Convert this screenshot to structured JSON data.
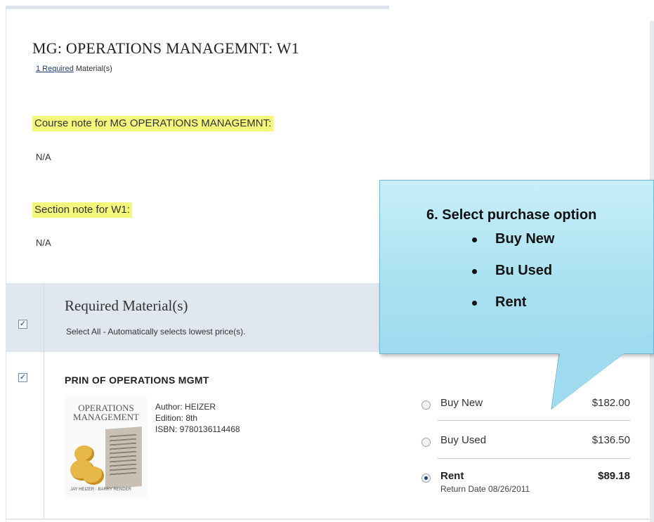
{
  "course": {
    "title": "MG:  OPERATIONS MANAGEMNT:  W1",
    "required_link": "1 Required",
    "required_suffix": " Material(s)"
  },
  "notes": {
    "course_note_label": "Course note for  MG  OPERATIONS MANAGEMNT:",
    "course_note_value": "N/A",
    "section_note_label": "Section note for W1:",
    "section_note_value": "N/A"
  },
  "required_section": {
    "title": "Required Material(s)",
    "select_all_text": "Select All - Automatically selects lowest price(s).",
    "select_all_checked": true
  },
  "book": {
    "checked": true,
    "title": "PRIN OF OPERATIONS MGMT",
    "author": "Author: HEIZER",
    "edition": "Edition: 8th",
    "isbn": "ISBN: 9780136114468",
    "cover_title": "OPERATIONS MANAGEMENT",
    "cover_authors": "JAY HEIZER  ·  BARRY RENDER"
  },
  "purchase_options": [
    {
      "label": "Buy New",
      "price": "$182.00",
      "selected": false
    },
    {
      "label": "Buy Used",
      "price": "$136.50",
      "selected": false
    },
    {
      "label": "Rent",
      "price": "$89.18",
      "selected": true,
      "sub": "Return Date 08/26/2011"
    }
  ],
  "callout": {
    "heading": "6.   Select purchase option",
    "items": [
      "Buy New",
      "Bu Used",
      "Rent"
    ]
  },
  "colors": {
    "highlight": "#f4f779",
    "band": "#e1e7ef",
    "callout_fill": "#a9e1f1",
    "link": "#1f3f7a"
  }
}
